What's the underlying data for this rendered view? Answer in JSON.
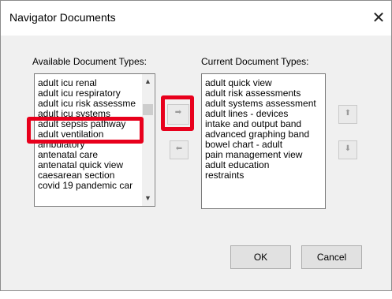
{
  "dialog": {
    "title": "Navigator Documents",
    "close_glyph": "✕"
  },
  "available": {
    "label": "Available Document Types:",
    "items": [
      "adult icu renal",
      "adult icu respiratory",
      "adult icu risk assessme",
      "adult icu systems",
      "adult sepsis pathway",
      "adult ventilation",
      "ambulatory",
      "antenatal care",
      "antenatal quick view",
      "caesarean section",
      "covid 19 pandemic car"
    ],
    "selected_index": 4
  },
  "current": {
    "label": "Current Document Types:",
    "items": [
      "adult quick view",
      "adult risk assessments",
      "adult systems assessment",
      "adult lines - devices",
      "intake and output band",
      "advanced graphing band",
      "bowel chart - adult",
      "pain management view",
      "adult education",
      "restraints"
    ]
  },
  "buttons": {
    "add_icon": "arrow-right-icon",
    "remove_icon": "arrow-left-icon",
    "move_up_icon": "arrow-up-icon",
    "move_down_icon": "arrow-down-icon",
    "ok": "OK",
    "cancel": "Cancel"
  },
  "highlight_color": "#e8001c"
}
